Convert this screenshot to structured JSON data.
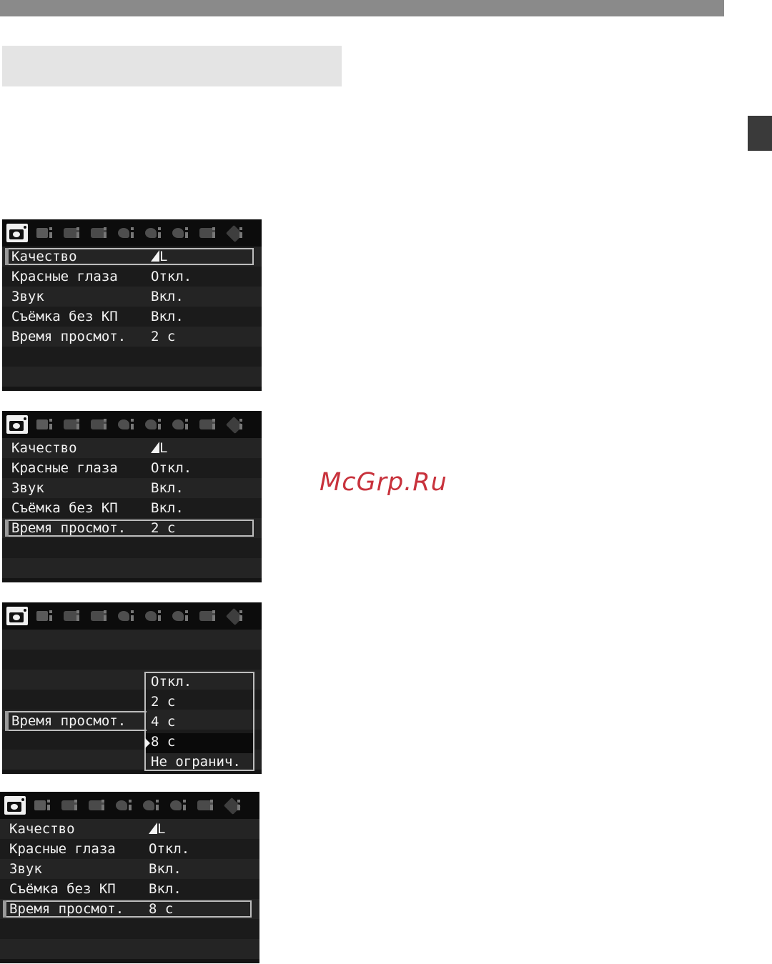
{
  "watermark": "McGrp.Ru",
  "tabs": [
    "camera-tab",
    "camera-2-tab",
    "playback-1-tab",
    "playback-2-tab",
    "setup-1-tab",
    "setup-2-tab",
    "setup-3-tab",
    "print-tab",
    "my-menu-tab"
  ],
  "screen1": {
    "rows": [
      {
        "label": "Качество",
        "value": "L"
      },
      {
        "label": "Красные глаза",
        "value": "Откл."
      },
      {
        "label": "Звук",
        "value": "Вкл."
      },
      {
        "label": "Съёмка без КП",
        "value": "Вкл."
      },
      {
        "label": "Время просмот.",
        "value": "2 с"
      }
    ],
    "selected_index": 0
  },
  "screen2": {
    "rows": [
      {
        "label": "Качество",
        "value": "L"
      },
      {
        "label": "Красные глаза",
        "value": "Откл."
      },
      {
        "label": "Звук",
        "value": "Вкл."
      },
      {
        "label": "Съёмка без КП",
        "value": "Вкл."
      },
      {
        "label": "Время просмот.",
        "value": "2 с"
      }
    ],
    "selected_index": 4
  },
  "screen3": {
    "item_label": "Время просмот.",
    "options": [
      "Откл.",
      "2 с",
      "4 с",
      "8 с",
      "Не огранич."
    ],
    "selected_option_index": 3
  },
  "screen4": {
    "rows": [
      {
        "label": "Качество",
        "value": "L"
      },
      {
        "label": "Красные глаза",
        "value": "Откл."
      },
      {
        "label": "Звук",
        "value": "Вкл."
      },
      {
        "label": "Съёмка без КП",
        "value": "Вкл."
      },
      {
        "label": "Время просмот.",
        "value": "8 с"
      }
    ],
    "selected_index": 4
  },
  "colors": {
    "screen_bg": "#141414",
    "text": "#f2f2f2",
    "frame": "#bdbdbd",
    "watermark": "#c8323c",
    "header_bar": "#8a8a8a"
  }
}
